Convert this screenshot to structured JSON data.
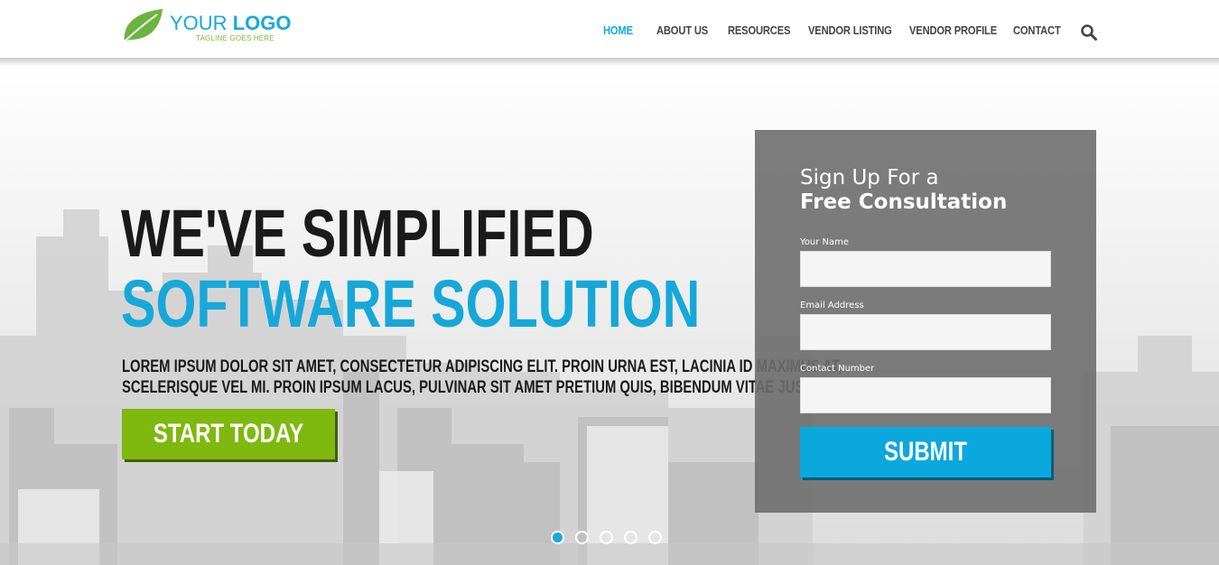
{
  "header": {
    "logo": {
      "text_light": "YOUR",
      "text_bold": "LOGO",
      "tagline": "TAGLINE GOES HERE"
    },
    "nav": [
      {
        "label": "HOME",
        "active": true
      },
      {
        "label": "ABOUT US",
        "active": false
      },
      {
        "label": "RESOURCES",
        "active": false
      },
      {
        "label": "VENDOR LISTING",
        "active": false
      },
      {
        "label": "VENDOR PROFILE",
        "active": false
      },
      {
        "label": "CONTACT",
        "active": false
      }
    ],
    "search_icon": "search-icon"
  },
  "hero": {
    "headline_line1": "WE'VE SIMPLIFIED",
    "headline_line2": "SOFTWARE SOLUTION",
    "subtext_line1": "LOREM IPSUM DOLOR SIT AMET, CONSECTETUR ADIPISCING ELIT. PROIN URNA EST, LACINIA ID MAXIMUS AT,",
    "subtext_line2": "SCELERISQUE VEL MI. PROIN IPSUM LACUS, PULVINAR SIT AMET PRETIUM QUIS, BIBENDUM VITAE JUSTO.",
    "cta_label": "START TODAY"
  },
  "form": {
    "title_line1": "Sign Up For a",
    "title_line2": "Free Consultation",
    "fields": [
      {
        "label": "Your Name",
        "value": ""
      },
      {
        "label": "Email Address",
        "value": ""
      },
      {
        "label": "Contact Number",
        "value": ""
      }
    ],
    "submit_label": "SUBMIT"
  },
  "slider": {
    "total_slides": 5,
    "active_slide": 1
  },
  "colors": {
    "accent_blue": "#17a9d9",
    "accent_green": "#7fb80e",
    "headline_dark": "#1a1a1a",
    "form_panel": "#6e6e6e"
  }
}
